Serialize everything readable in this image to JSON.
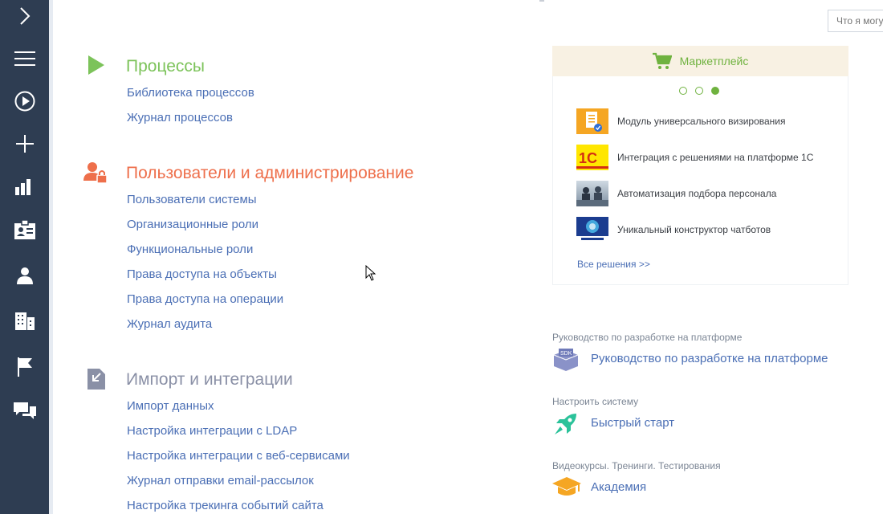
{
  "nav": {
    "items": [
      {
        "name": "expand-chevron-icon"
      },
      {
        "name": "menu-icon"
      },
      {
        "name": "play-circle-icon"
      },
      {
        "name": "plus-icon"
      },
      {
        "name": "bar-chart-icon"
      },
      {
        "name": "contact-card-icon"
      },
      {
        "name": "user-icon"
      },
      {
        "name": "building-icon"
      },
      {
        "name": "flag-icon"
      },
      {
        "name": "chat-icon"
      }
    ]
  },
  "search": {
    "placeholder": "Что я могу"
  },
  "sections": {
    "processes": {
      "title": "Процессы",
      "color": "#7cc35a",
      "links": [
        "Библиотека процессов",
        "Журнал процессов"
      ]
    },
    "users": {
      "title": "Пользователи и администрирование",
      "color": "#ee6f4b",
      "links": [
        "Пользователи системы",
        "Организационные роли",
        "Функциональные роли",
        "Права доступа на объекты",
        "Права доступа на операции",
        "Журнал аудита"
      ]
    },
    "import": {
      "title": "Импорт и интеграции",
      "color": "#8a90a6",
      "links": [
        "Импорт данных",
        "Настройка интеграции с LDAP",
        "Настройка интеграции с веб-сервисами",
        "Журнал отправки email-рассылок",
        "Настройка трекинга событий сайта"
      ]
    }
  },
  "marketplace": {
    "title": "Маркетплейс",
    "accent": "#6fb23f",
    "active_slide": 3,
    "items": [
      {
        "label": "Модуль универсального визирования",
        "icon": "document-approval-icon"
      },
      {
        "label": "Интеграция с решениями на платформе 1С",
        "icon": "1c-logo-icon"
      },
      {
        "label": "Автоматизация подбора персонала",
        "icon": "meeting-photo-icon"
      },
      {
        "label": "Уникальный конструктор чатботов",
        "icon": "chatbot-icon"
      }
    ],
    "all_solutions": "Все решения >>"
  },
  "help": [
    {
      "caption": "Руководство по разработке на платформе",
      "link": "Руководство по разработке на платформе",
      "icon": "sdk-box-icon"
    },
    {
      "caption": "Настроить систему",
      "link": "Быстрый старт",
      "icon": "rocket-icon"
    },
    {
      "caption": "Видеокурсы. Тренинги. Тестирования",
      "link": "Академия",
      "icon": "graduation-cap-icon"
    }
  ]
}
